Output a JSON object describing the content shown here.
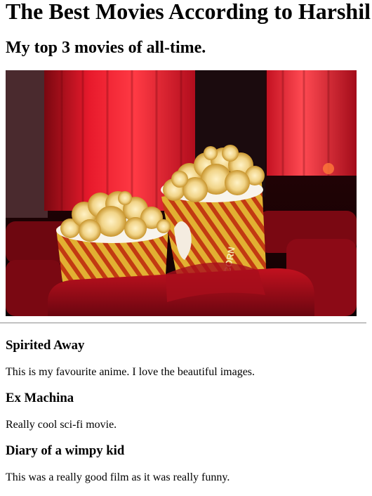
{
  "page": {
    "title": "The Best Movies According to Harshil",
    "subtitle": "My top 3 movies of all-time."
  },
  "hero_image": {
    "description_icon": "popcorn-cinema-image",
    "bucket_text": "CORN"
  },
  "movies": [
    {
      "title": "Spirited Away",
      "description": "This is my favourite anime. I love the beautiful images."
    },
    {
      "title": "Ex Machina",
      "description": "Really cool sci-fi movie."
    },
    {
      "title": "Diary of a wimpy kid",
      "description": "This was a really good film as it was really funny."
    }
  ],
  "colors": {
    "curtain_red": "#d8192c",
    "seat_red": "#b3101c",
    "bucket_stripe": "#d6a21c"
  }
}
